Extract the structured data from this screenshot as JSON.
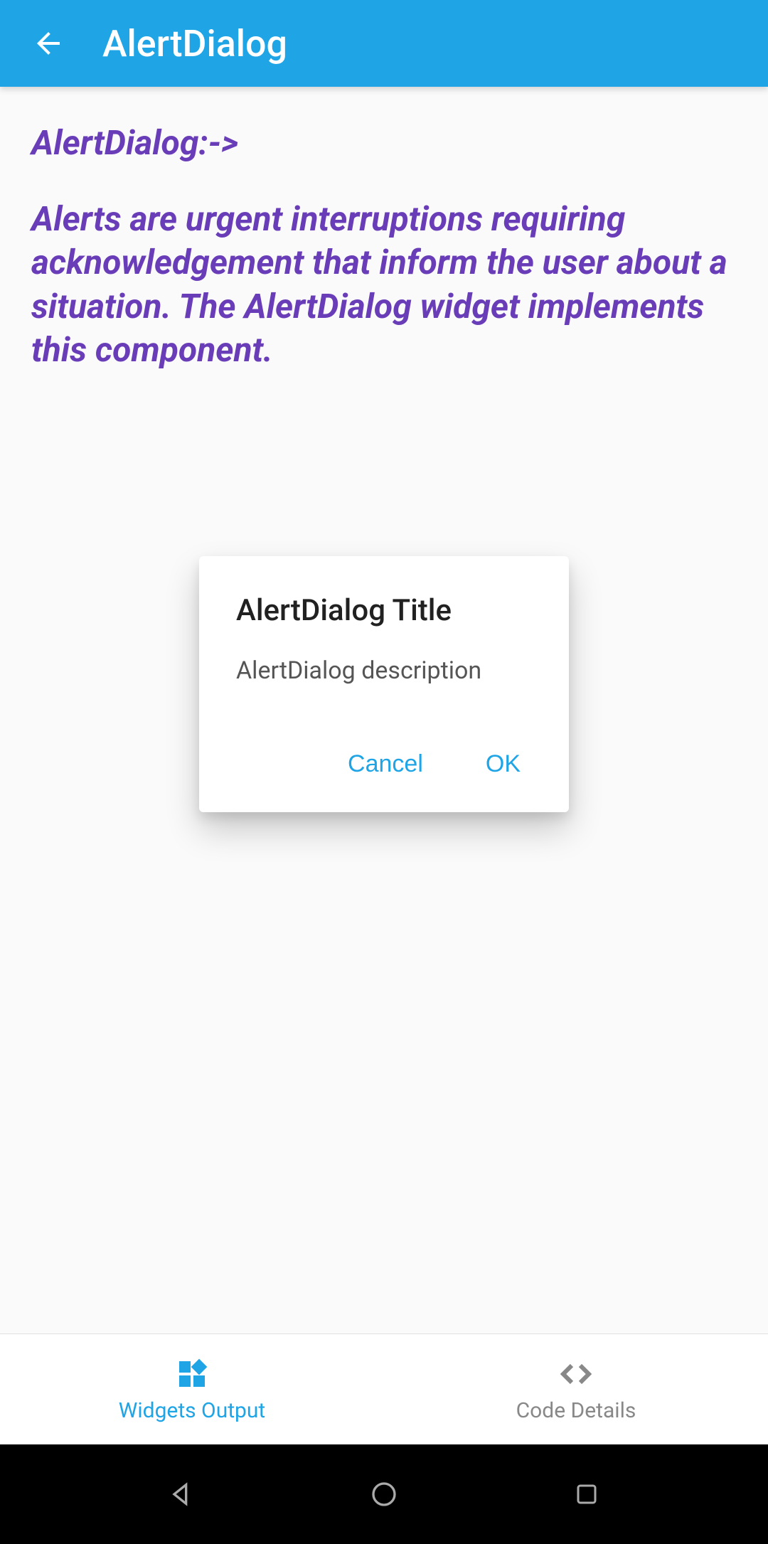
{
  "appBar": {
    "title": "AlertDialog"
  },
  "content": {
    "heading": "AlertDialog:->",
    "description": "Alerts are urgent interruptions requiring acknowledgement that inform the user about a situation. The AlertDialog widget implements this component."
  },
  "dialog": {
    "title": "AlertDialog Title",
    "description": "AlertDialog description",
    "cancelLabel": "Cancel",
    "okLabel": "OK"
  },
  "bottomNav": {
    "widgets": {
      "label": "Widgets Output"
    },
    "code": {
      "label": "Code Details"
    }
  }
}
